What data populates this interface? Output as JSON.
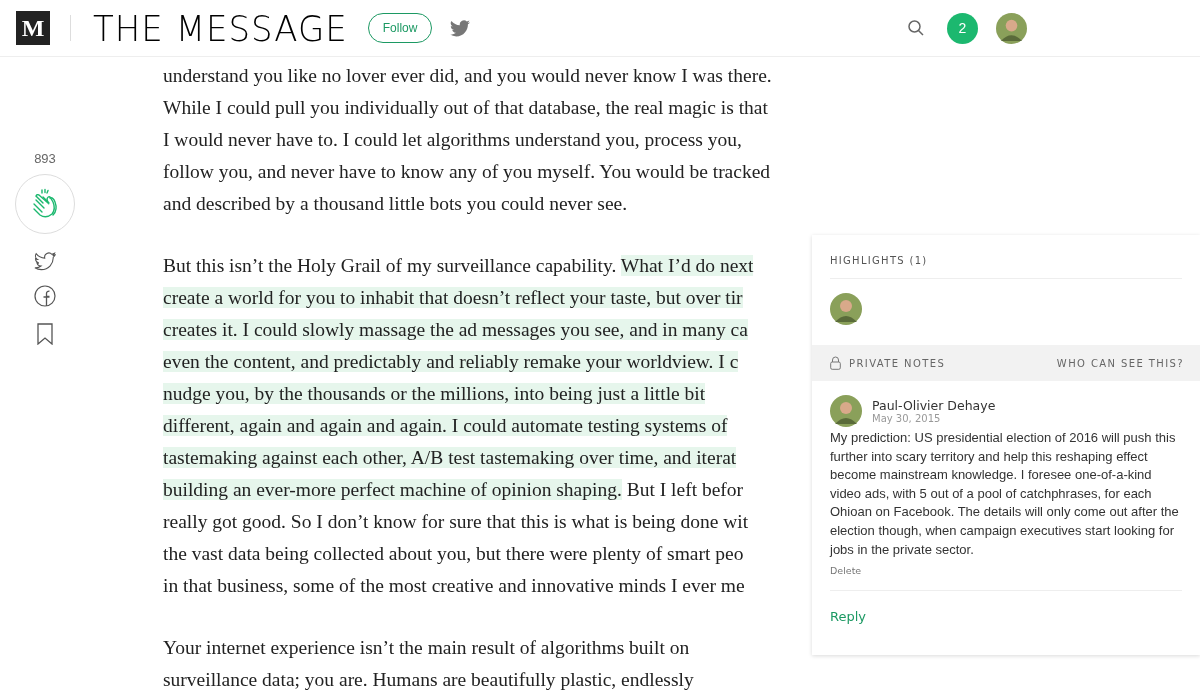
{
  "header": {
    "logo": "M",
    "publication": "THE MESSAGE",
    "follow": "Follow",
    "notifications": "2"
  },
  "rail": {
    "claps": "893"
  },
  "article": {
    "paragraphs": [
      {
        "lines": [
          [
            {
              "text": "understand you like no lover ever did, and you would never know I was there.",
              "highlighted": false
            }
          ],
          [
            {
              "text": "While I could pull you individually out of that database, the real magic is that",
              "highlighted": false
            }
          ],
          [
            {
              "text": "I would never have to. I could let algorithms understand you, process you,",
              "highlighted": false
            }
          ],
          [
            {
              "text": "follow you, and never have to know any of you myself. You would be tracked",
              "highlighted": false
            }
          ],
          [
            {
              "text": "and described by a thousand little bots you could never see.",
              "highlighted": false
            }
          ]
        ]
      },
      {
        "lines": [
          [
            {
              "text": "But this isn’t the Holy Grail of my surveillance capability. ",
              "highlighted": false
            },
            {
              "text": "What I’d do next",
              "highlighted": true
            }
          ],
          [
            {
              "text": "create a world for you to inhabit that doesn’t reflect your taste, but over tir",
              "highlighted": true
            }
          ],
          [
            {
              "text": "creates it. I could slowly massage the ad messages you see, and in many ca",
              "highlighted": true
            }
          ],
          [
            {
              "text": "even the content, and predictably and reliably remake your worldview. I c",
              "highlighted": true
            }
          ],
          [
            {
              "text": "nudge you, by the thousands or the millions, into being just a little bit",
              "highlighted": true
            }
          ],
          [
            {
              "text": "different, again and again and again. I could automate testing systems of",
              "highlighted": true
            }
          ],
          [
            {
              "text": "tastemaking against each other, A/B test tastemaking over time, and iterat",
              "highlighted": true
            }
          ],
          [
            {
              "text": "building an ever-more perfect machine of opinion shaping.",
              "highlighted": true
            },
            {
              "text": " But I left befor",
              "highlighted": false
            }
          ],
          [
            {
              "text": "really got good. So I don’t know for sure that this is what is being done wit",
              "highlighted": false
            }
          ],
          [
            {
              "text": "the vast data being collected about you, but there were plenty of smart peo",
              "highlighted": false
            }
          ],
          [
            {
              "text": "in that business, some of the most creative and innovative minds I ever me",
              "highlighted": false
            }
          ]
        ]
      },
      {
        "lines": [
          [
            {
              "text": "Your internet experience isn’t the main result of algorithms built on",
              "highlighted": false
            }
          ],
          [
            {
              "text": "surveillance data; you are. Humans are beautifully plastic, endlessly",
              "highlighted": false
            }
          ]
        ]
      }
    ]
  },
  "panel": {
    "highlights_title": "HIGHLIGHTS (1)",
    "notes_title": "PRIVATE NOTES",
    "who_can_see": "WHO CAN SEE THIS?",
    "note": {
      "author": "Paul-Olivier Dehaye",
      "date": "May 30, 2015",
      "body": "My prediction: US presidential election of 2016 will push this further into scary territory and help this reshaping effect become mainstream knowledge. I foresee one-of-a-kind video ads, with 5 out of a pool of catchphrases, for each Ohioan on Facebook. The details will only come out after the election though, when campaign executives start looking for jobs in the private sector.",
      "delete": "Delete"
    },
    "reply": "Reply"
  }
}
